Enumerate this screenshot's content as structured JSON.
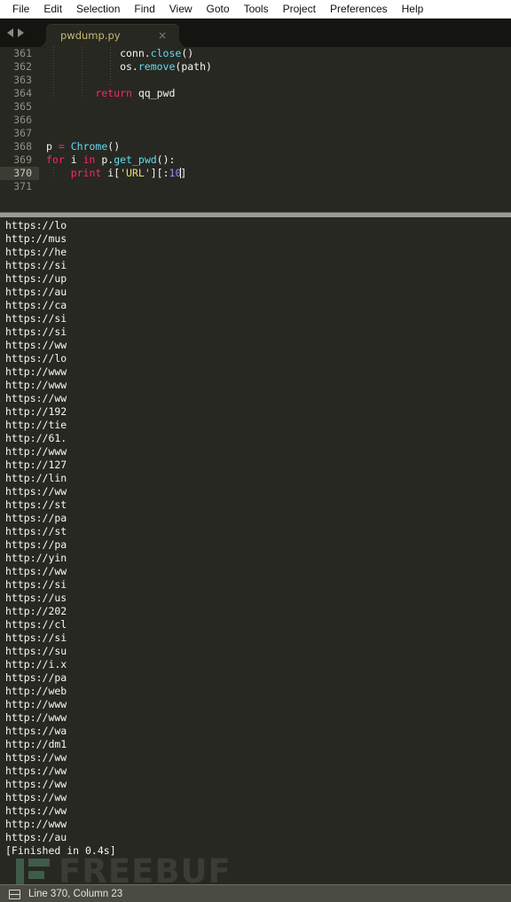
{
  "menu": {
    "items": [
      "File",
      "Edit",
      "Selection",
      "Find",
      "View",
      "Goto",
      "Tools",
      "Project",
      "Preferences",
      "Help"
    ]
  },
  "tabbar": {
    "nav_back_icon": "triangle-left-icon",
    "nav_forward_icon": "triangle-right-icon",
    "tab_label": "pwdump.py",
    "tab_close_glyph": "×"
  },
  "editor": {
    "lines": [
      {
        "num": "361",
        "current": false,
        "guides": 3,
        "tokens": [
          {
            "t": "            conn.",
            "c": "def"
          },
          {
            "t": "close",
            "c": "fn"
          },
          {
            "t": "()",
            "c": "punc"
          }
        ]
      },
      {
        "num": "362",
        "current": false,
        "guides": 3,
        "tokens": [
          {
            "t": "            os.",
            "c": "def"
          },
          {
            "t": "remove",
            "c": "fn"
          },
          {
            "t": "(path)",
            "c": "punc"
          }
        ]
      },
      {
        "num": "363",
        "current": false,
        "guides": 3,
        "tokens": []
      },
      {
        "num": "364",
        "current": false,
        "guides": 2,
        "tokens": [
          {
            "t": "        ",
            "c": "def"
          },
          {
            "t": "return",
            "c": "kw"
          },
          {
            "t": " qq_pwd",
            "c": "def"
          }
        ]
      },
      {
        "num": "365",
        "current": false,
        "guides": 0,
        "tokens": []
      },
      {
        "num": "366",
        "current": false,
        "guides": 0,
        "tokens": []
      },
      {
        "num": "367",
        "current": false,
        "guides": 0,
        "tokens": []
      },
      {
        "num": "368",
        "current": false,
        "guides": 0,
        "tokens": [
          {
            "t": "p ",
            "c": "def"
          },
          {
            "t": "=",
            "c": "kw"
          },
          {
            "t": " ",
            "c": "def"
          },
          {
            "t": "Chrome",
            "c": "fn"
          },
          {
            "t": "()",
            "c": "punc"
          }
        ]
      },
      {
        "num": "369",
        "current": false,
        "guides": 0,
        "tokens": [
          {
            "t": "for",
            "c": "kw"
          },
          {
            "t": " i ",
            "c": "def"
          },
          {
            "t": "in",
            "c": "kw"
          },
          {
            "t": " p.",
            "c": "def"
          },
          {
            "t": "get_pwd",
            "c": "fn"
          },
          {
            "t": "():",
            "c": "punc"
          }
        ]
      },
      {
        "num": "370",
        "current": true,
        "guides": 1,
        "tokens": [
          {
            "t": "    ",
            "c": "def"
          },
          {
            "t": "print",
            "c": "kw"
          },
          {
            "t": " i",
            "c": "def"
          },
          {
            "t": "[",
            "c": "punc"
          },
          {
            "t": "'URL'",
            "c": "str"
          },
          {
            "t": "][:",
            "c": "punc"
          },
          {
            "t": "10",
            "c": "num"
          },
          {
            "t": "|",
            "c": "caret"
          },
          {
            "t": "]",
            "c": "punc"
          }
        ]
      },
      {
        "num": "371",
        "current": false,
        "guides": 0,
        "tokens": []
      }
    ]
  },
  "console": {
    "lines": [
      "https://lo",
      "http://mus",
      "https://he",
      "https://si",
      "https://up",
      "https://au",
      "https://ca",
      "https://si",
      "https://si",
      "https://ww",
      "https://lo",
      "http://www",
      "http://www",
      "https://ww",
      "http://192",
      "http://tie",
      "http://61.",
      "http://www",
      "http://127",
      "http://lin",
      "https://ww",
      "https://st",
      "https://pa",
      "https://st",
      "https://pa",
      "http://yin",
      "https://ww",
      "https://si",
      "https://us",
      "http://202",
      "https://cl",
      "https://si",
      "https://su",
      "http://i.x",
      "https://pa",
      "http://web",
      "http://www",
      "http://www",
      "https://wa",
      "http://dm1",
      "https://ww",
      "https://ww",
      "https://ww",
      "https://ww",
      "https://ww",
      "http://www",
      "https://au",
      "[Finished in 0.4s]"
    ]
  },
  "watermark": {
    "text": "FREEBUF",
    "logo_icon": "freebuf-logo-icon"
  },
  "statusbar": {
    "icon": "panel-layout-icon",
    "text": "Line 370, Column 23"
  },
  "colors": {
    "editor_bg": "#272822",
    "keyword": "#f92672",
    "function": "#66d9ef",
    "string": "#e6db74",
    "number": "#ae81ff",
    "foreground": "#f8f8f2",
    "tab_label": "#c9b870",
    "statusbar_bg": "#4a4c44"
  }
}
